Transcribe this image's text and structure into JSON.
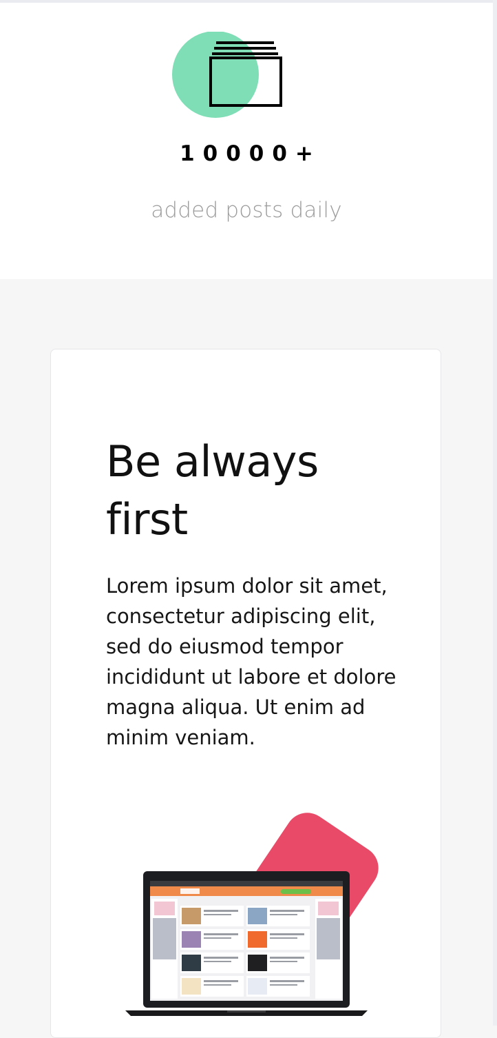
{
  "stat": {
    "icon": "stacked-posts-icon",
    "value": "10000+",
    "caption": "added posts daily",
    "accent_color": "#7fdeb6"
  },
  "feature": {
    "title_line1": "Be always",
    "title_line2": "first",
    "body": "Lorem ipsum dolor sit amet, consectetur adipiscing elit, sed do eiusmod tempor incididunt ut labore et dolore magna aliqua. Ut enim ad minim veniam.",
    "decor_color": "#e84a67",
    "device_image": "laptop-screenshot-image"
  }
}
